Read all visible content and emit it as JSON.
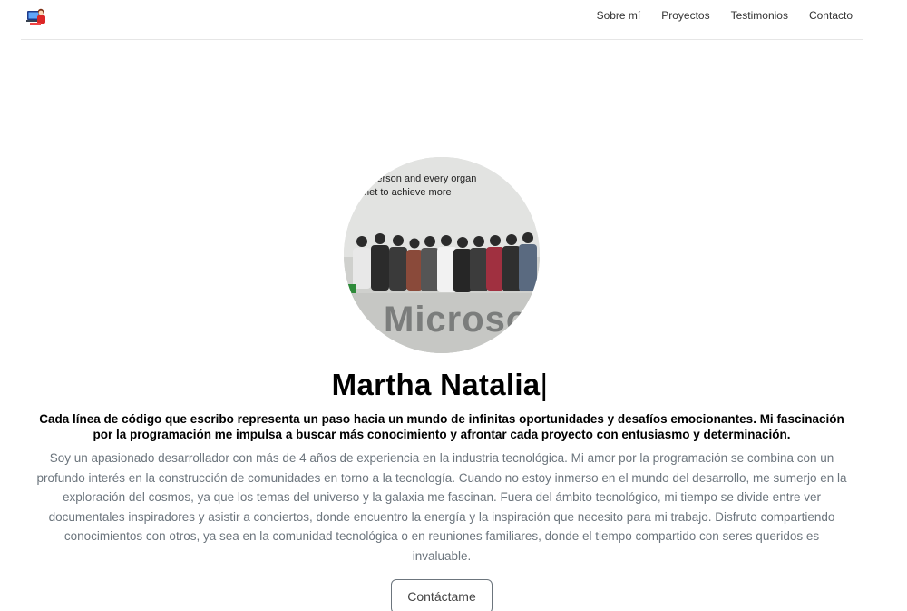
{
  "nav": {
    "logo_icon": "developer-laptop-icon",
    "links": [
      "Sobre mí",
      "Proyectos",
      "Testimonios",
      "Contacto"
    ]
  },
  "hero": {
    "photo_sign_text": [
      "ry person and every organ",
      "net to achieve more"
    ],
    "photo_logo_text": "Microso",
    "name": "Martha Natalia",
    "cursor": "|",
    "tagline": "Cada línea de código que escribo representa un paso hacia un mundo de infinitas oportunidades y desafíos emocionantes. Mi fascinación por la programación me impulsa a buscar más conocimiento y afrontar cada proyecto con entusiasmo y determinación.",
    "bio": "Soy un apasionado desarrollador con más de 4 años de experiencia en la industria tecnológica. Mi amor por la programación se combina con un profundo interés en la construcción de comunidades en torno a la tecnología. Cuando no estoy inmerso en el mundo del desarrollo, me sumerjo en la exploración del cosmos, ya que los temas del universo y la galaxia me fascinan. Fuera del ámbito tecnológico, mi tiempo se divide entre ver documentales inspiradores y asistir a conciertos, donde encuentro la energía y la inspiración que necesito para mi trabajo. Disfruto compartiendo conocimientos con otros, ya sea en la comunidad tecnológica o en reuniones familiares, donde el tiempo compartido con seres queridos es invaluable.",
    "contact_label": "Contáctame"
  },
  "colors": {
    "muted_text": "#6c757d",
    "heading": "#000000",
    "nav_text": "#333333"
  }
}
